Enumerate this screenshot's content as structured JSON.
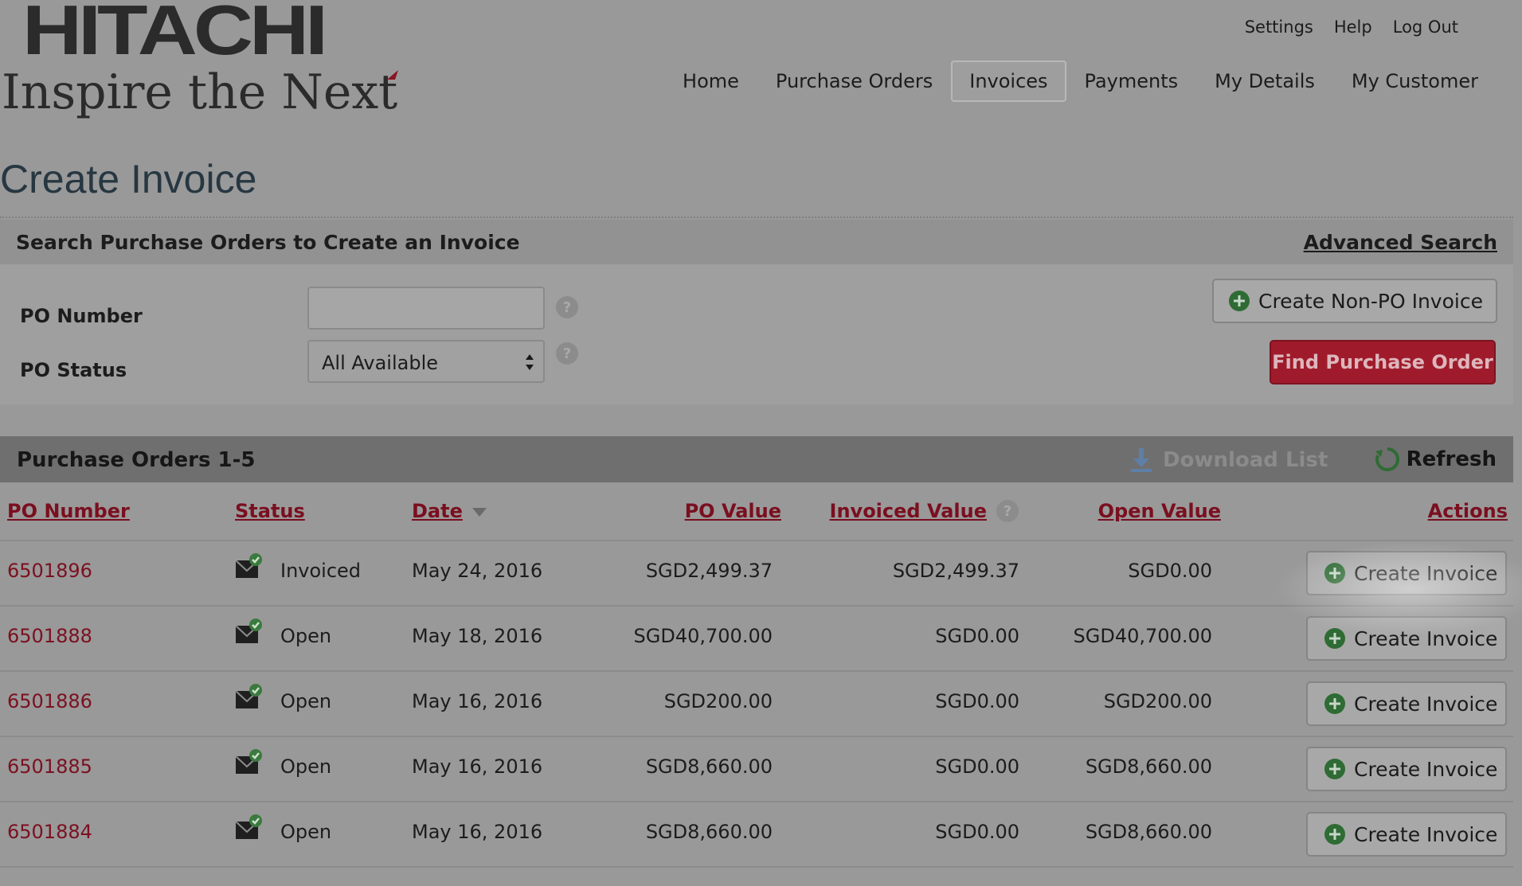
{
  "brand": {
    "name": "HITACHI",
    "tagline": "Inspire the Next"
  },
  "util_nav": [
    "Settings",
    "Help",
    "Log Out"
  ],
  "main_nav": [
    {
      "label": "Home",
      "active": false
    },
    {
      "label": "Purchase Orders",
      "active": false
    },
    {
      "label": "Invoices",
      "active": true
    },
    {
      "label": "Payments",
      "active": false
    },
    {
      "label": "My Details",
      "active": false
    },
    {
      "label": "My Customer",
      "active": false
    }
  ],
  "page": {
    "title": "Create Invoice"
  },
  "search": {
    "heading": "Search Purchase Orders to Create an Invoice",
    "advanced_link": "Advanced Search",
    "po_number_label": "PO Number",
    "po_number_value": "",
    "po_status_label": "PO Status",
    "po_status_value": "All Available",
    "create_nonpo_label": "Create Non-PO Invoice",
    "find_label": "Find Purchase Order"
  },
  "list": {
    "heading": "Purchase Orders 1-5",
    "download_label": "Download List",
    "refresh_label": "Refresh",
    "columns": {
      "po_number": "PO Number",
      "status": "Status",
      "date": "Date",
      "po_value": "PO Value",
      "invoiced_value": "Invoiced Value",
      "open_value": "Open Value",
      "actions": "Actions"
    },
    "action_label": "Create Invoice",
    "rows": [
      {
        "po": "6501896",
        "status": "Invoiced",
        "date": "May 24, 2016",
        "po_value": "SGD2,499.37",
        "invoiced": "SGD2,499.37",
        "open": "SGD0.00"
      },
      {
        "po": "6501888",
        "status": "Open",
        "date": "May 18, 2016",
        "po_value": "SGD40,700.00",
        "invoiced": "SGD0.00",
        "open": "SGD40,700.00"
      },
      {
        "po": "6501886",
        "status": "Open",
        "date": "May 16, 2016",
        "po_value": "SGD200.00",
        "invoiced": "SGD0.00",
        "open": "SGD200.00"
      },
      {
        "po": "6501885",
        "status": "Open",
        "date": "May 16, 2016",
        "po_value": "SGD8,660.00",
        "invoiced": "SGD0.00",
        "open": "SGD8,660.00"
      },
      {
        "po": "6501884",
        "status": "Open",
        "date": "May 16, 2016",
        "po_value": "SGD8,660.00",
        "invoiced": "SGD0.00",
        "open": "SGD8,660.00"
      }
    ]
  },
  "colors": {
    "brand_red": "#9f1b2b",
    "link_red": "#7c1020",
    "plus_green": "#2f6b34",
    "check_green": "#3a7a3e"
  },
  "icons": {
    "plus": "plus-circle-icon",
    "help": "question-circle-icon",
    "download": "download-arrow-icon",
    "refresh": "refresh-circle-icon",
    "status": "envelope-check-icon",
    "sort": "sort-desc-icon",
    "select": "select-arrows-icon"
  }
}
